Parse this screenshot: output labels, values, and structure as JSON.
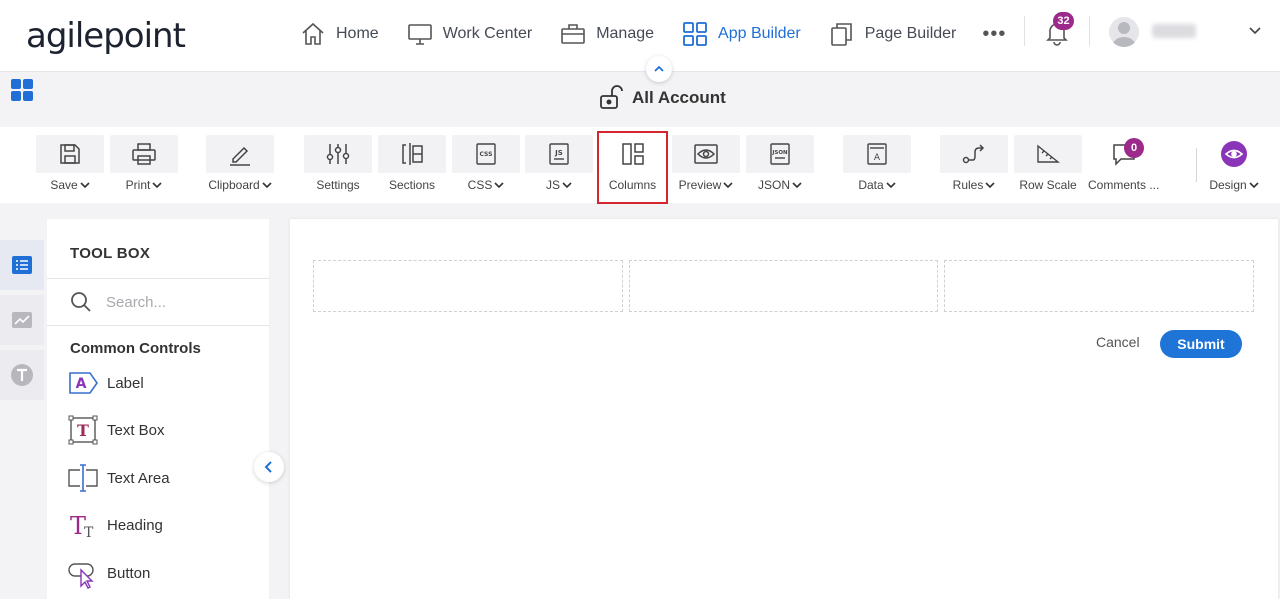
{
  "header": {
    "logo": "agilepoint",
    "nav": [
      {
        "label": "Home",
        "icon": "home-icon"
      },
      {
        "label": "Work Center",
        "icon": "monitor-icon"
      },
      {
        "label": "Manage",
        "icon": "briefcase-icon"
      },
      {
        "label": "App Builder",
        "icon": "grid-icon",
        "active": true
      },
      {
        "label": "Page Builder",
        "icon": "copy-icon"
      }
    ],
    "more": "•••",
    "notifications": "32",
    "accent_color": "#1f6fd6",
    "badge_color": "#9c2a8b"
  },
  "titlebar": {
    "title": "All Account"
  },
  "toolbar": {
    "items": [
      {
        "label": "Save",
        "dropdown": true
      },
      {
        "label": "Print",
        "dropdown": true
      },
      {
        "label": "Clipboard",
        "dropdown": true
      },
      {
        "label": "Settings",
        "dropdown": false
      },
      {
        "label": "Sections",
        "dropdown": false
      },
      {
        "label": "CSS",
        "dropdown": true
      },
      {
        "label": "JS",
        "dropdown": true
      },
      {
        "label": "Columns",
        "dropdown": false,
        "highlighted": true
      },
      {
        "label": "Preview",
        "dropdown": true
      },
      {
        "label": "JSON",
        "dropdown": true
      },
      {
        "label": "Data",
        "dropdown": true
      },
      {
        "label": "Rules",
        "dropdown": true
      },
      {
        "label": "Row Scale",
        "dropdown": false
      },
      {
        "label": "Comments ...",
        "dropdown": false
      },
      {
        "label": "Design",
        "dropdown": true
      }
    ],
    "comments_count": "0"
  },
  "toolbox": {
    "title": "TOOL BOX",
    "search_placeholder": "Search...",
    "section": "Common Controls",
    "controls": [
      {
        "label": "Label",
        "icon": "label-icon"
      },
      {
        "label": "Text Box",
        "icon": "textbox-icon"
      },
      {
        "label": "Text Area",
        "icon": "textarea-icon"
      },
      {
        "label": "Heading",
        "icon": "heading-icon"
      },
      {
        "label": "Button",
        "icon": "button-icon"
      }
    ]
  },
  "form": {
    "columns": 3,
    "cancel_label": "Cancel",
    "submit_label": "Submit",
    "submit_color": "#1f74d8"
  }
}
